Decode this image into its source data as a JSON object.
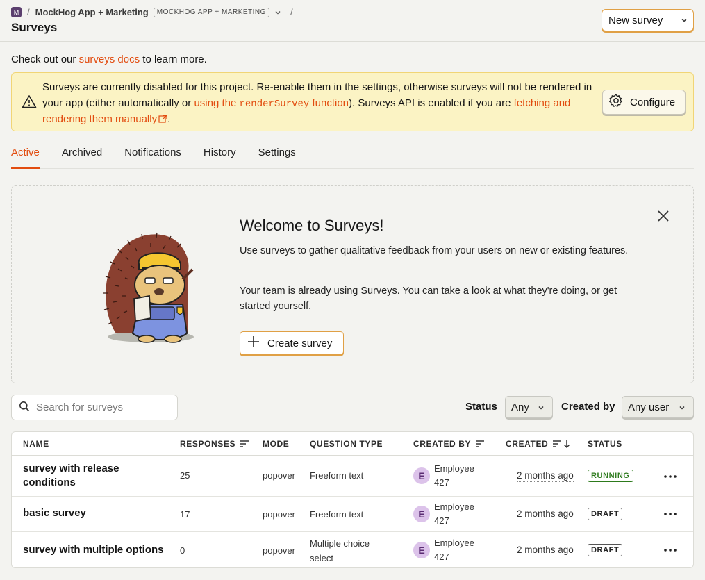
{
  "breadcrumb": {
    "avatar_letter": "M",
    "separator": "/",
    "project": "MockHog App + Marketing",
    "project_tag": "MOCKHOG APP + MARKETING"
  },
  "page_title": "Surveys",
  "new_survey_label": "New survey",
  "intro": {
    "prefix": "Check out our ",
    "link": "surveys docs",
    "suffix": " to learn more."
  },
  "banner": {
    "text1": "Surveys are currently disabled for this project. Re-enable them in the settings, otherwise surveys will not be rendered in your app (either automatically or ",
    "link1a": "using the ",
    "link1b": "renderSurvey",
    "link1c": " function",
    "text2": "). Surveys API is enabled if you are ",
    "link2": "fetching and rendering them manually",
    "text3": ".",
    "configure_label": "Configure"
  },
  "tabs": [
    "Active",
    "Archived",
    "Notifications",
    "History",
    "Settings"
  ],
  "welcome": {
    "title": "Welcome to Surveys!",
    "p1": "Use surveys to gather qualitative feedback from your users on new or existing features.",
    "p2": "Your team is already using Surveys. You can take a look at what they're doing, or get started yourself.",
    "create_label": "Create survey"
  },
  "filters": {
    "search_placeholder": "Search for surveys",
    "status_label": "Status",
    "status_value": "Any",
    "created_by_label": "Created by",
    "created_by_value": "Any user"
  },
  "table": {
    "columns": [
      "NAME",
      "RESPONSES",
      "MODE",
      "QUESTION TYPE",
      "CREATED BY",
      "CREATED",
      "STATUS"
    ],
    "rows": [
      {
        "name": "survey with release conditions",
        "responses": "25",
        "mode": "popover",
        "question_type": "Freeform text",
        "creator_initial": "E",
        "creator": "Employee 427",
        "created": "2 months ago",
        "status": "RUNNING"
      },
      {
        "name": "basic survey",
        "responses": "17",
        "mode": "popover",
        "question_type": "Freeform text",
        "creator_initial": "E",
        "creator": "Employee 427",
        "created": "2 months ago",
        "status": "DRAFT"
      },
      {
        "name": "survey with multiple options",
        "responses": "0",
        "mode": "popover",
        "question_type": "Multiple choice select",
        "creator_initial": "E",
        "creator": "Employee 427",
        "created": "2 months ago",
        "status": "DRAFT"
      }
    ]
  },
  "colors": {
    "accent": "#e24c0f",
    "warning_bg": "#fbf3c4",
    "running": "#2d7a1c"
  }
}
